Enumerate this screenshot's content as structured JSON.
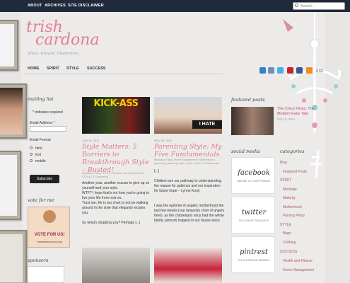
{
  "topnav": [
    "ABOUT",
    "ARCHIVES",
    "SITE DISCLAIMER"
  ],
  "search": {
    "placeholder": "Search..."
  },
  "logo": {
    "line1": "trish",
    "line2": "cardona"
  },
  "tagline": "Ideas. Insight. Inspiration.",
  "mainnav": [
    "HOME",
    "SPIRIT",
    "STYLE",
    "SUCCESS"
  ],
  "rss_label": "RSS",
  "sidebar": {
    "mailing_title": "mailing list",
    "required_note": "* indicates required",
    "email_label": "Email Address *",
    "format_label": "Email Format",
    "formats": [
      "html",
      "text",
      "mobile"
    ],
    "subscribe": "Subscribe",
    "vote_title": "vote for me",
    "vote_badge": "VOTE FOR US!",
    "vote_site": "TOPMOMMYBLOGS.COM",
    "sponsors_title": "sponsors"
  },
  "posts": [
    {
      "date": "JUN 16, 2011",
      "title": "Style Matters: 5 Barriers to Breakthrough Style – Busted!",
      "meta": "trishdana / Blog, STYLE / fashion, self-improvement, STYLE / 4 Comments",
      "body": [
        "Another year, another excuse to give up on yourself and your style.",
        "WTF? I hope that's not how you're going to live your life from now on.",
        "Trust me, life is too short to not be walking around in the style that elegantly exudes you.",
        "So what's stopping you? Perhaps [...]"
      ],
      "image_text": "KICK-ASS"
    },
    {
      "date": "NOV 25, 2011",
      "title": "Parenting Style: My Five Fundamentals",
      "meta": "trishdana / Blog, Home Management, Motherhood / parenting, parenting style, super mother / 3 Comments",
      "body": [
        "[...]",
        "Children are our pathway to understanding, the reason for patience and our inspiration for future hope – Lynne Kooij",
        "I was the epitome of angelic motherhood the last few weeks (cue heavenly choir of angels here), as the chickenpox virus had the whole family (almost) trapped in our house since"
      ],
      "image_text": "I HATE"
    }
  ],
  "right": {
    "featured_title": "featured posts",
    "featured_item": "The Chick Flicks: The Modern Fairy Tale",
    "featured_date": "Oct 12, 2011",
    "social_title": "social media",
    "badges": [
      {
        "name": "facebook",
        "sub": "ADD ME TO YOUR FRIENDS"
      },
      {
        "name": "twitter",
        "sub": "FOLLOW MY THOUGHTS"
      },
      {
        "name": "pintrest",
        "sub": "PIN IT & FIND MY BOARDS"
      }
    ],
    "categories_title": "categories",
    "categories": [
      {
        "label": "Blog",
        "sub": false
      },
      {
        "label": "Featured Posts",
        "sub": true
      },
      {
        "label": "SPIRIT",
        "sub": false
      },
      {
        "label": "Marriage",
        "sub": true
      },
      {
        "label": "Maturity",
        "sub": true
      },
      {
        "label": "Motherhood",
        "sub": true
      },
      {
        "label": "Pursing Pinoy",
        "sub": true
      },
      {
        "label": "STYLE",
        "sub": false
      },
      {
        "label": "Bags",
        "sub": true
      },
      {
        "label": "Clothing",
        "sub": true
      },
      {
        "label": "SUCCESS",
        "sub": false
      },
      {
        "label": "Health and Fitness",
        "sub": true
      },
      {
        "label": "Home Management",
        "sub": true
      }
    ]
  },
  "colors": {
    "accent_pink": "#e07a92",
    "topbar": "#1f2a3a"
  }
}
